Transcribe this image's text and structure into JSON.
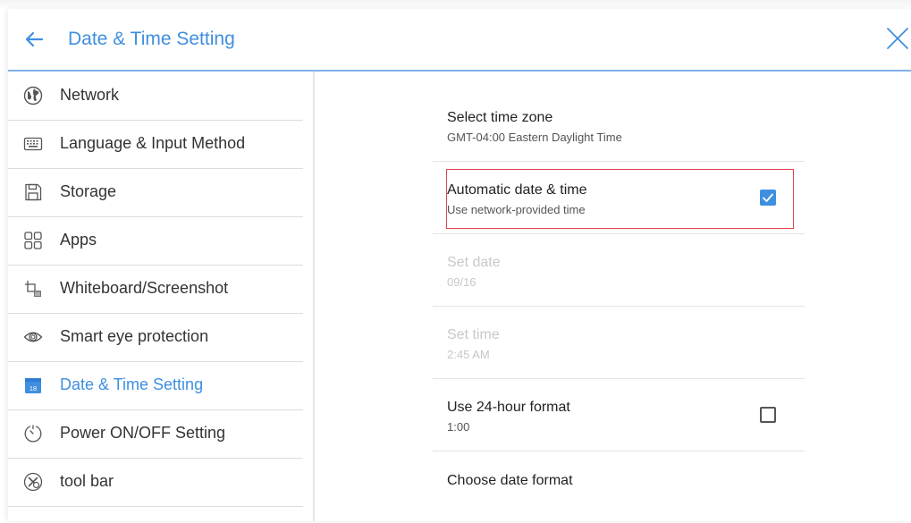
{
  "header": {
    "title": "Date & Time Setting",
    "back_icon": "arrow-left-icon",
    "close_icon": "close-icon",
    "accent_color": "#3f8fe0"
  },
  "sidebar": {
    "items": [
      {
        "label": "Network",
        "icon": "globe-icon",
        "active": false
      },
      {
        "label": "Language & Input Method",
        "icon": "keyboard-icon",
        "active": false
      },
      {
        "label": "Storage",
        "icon": "storage-icon",
        "active": false
      },
      {
        "label": "Apps",
        "icon": "apps-grid-icon",
        "active": false
      },
      {
        "label": "Whiteboard/Screenshot",
        "icon": "whiteboard-icon",
        "active": false
      },
      {
        "label": "Smart eye protection",
        "icon": "eye-icon",
        "active": false
      },
      {
        "label": "Date & Time Setting",
        "icon": "calendar-icon",
        "calendar_day": "18",
        "active": true
      },
      {
        "label": "Power ON/OFF Setting",
        "icon": "power-timer-icon",
        "active": false
      },
      {
        "label": "tool bar",
        "icon": "tools-icon",
        "active": false
      }
    ]
  },
  "settings": {
    "timezone": {
      "title": "Select time zone",
      "subtitle": "GMT-04:00 Eastern Daylight Time"
    },
    "auto_time": {
      "title": "Automatic date & time",
      "subtitle": "Use network-provided time",
      "checked": true
    },
    "set_date": {
      "title": "Set date",
      "subtitle": "09/16",
      "disabled": true
    },
    "set_time": {
      "title": "Set time",
      "subtitle": "2:45 AM",
      "disabled": true
    },
    "hour24": {
      "title": "Use 24-hour format",
      "subtitle": "1:00",
      "checked": false
    },
    "date_format": {
      "title": "Choose date format"
    }
  },
  "colors": {
    "highlight_border": "#e0444c",
    "divider": "#7fb2e8"
  }
}
